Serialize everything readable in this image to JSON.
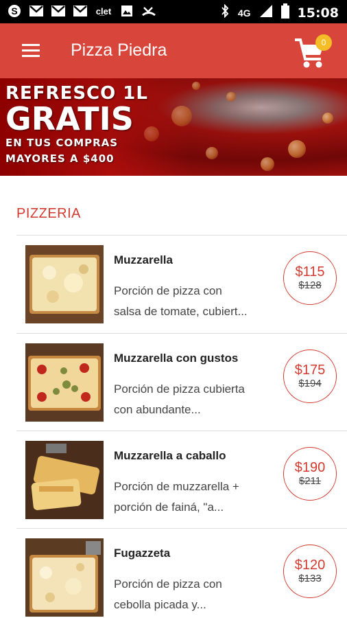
{
  "status_bar": {
    "time": "15:08",
    "network": "4G",
    "left_icons": [
      "skype-icon",
      "gmail-icon",
      "gmail-icon",
      "gmail-icon",
      "clarin-icon",
      "image-icon",
      "missed-call-icon"
    ],
    "clarin_label": "cl̲et"
  },
  "app_bar": {
    "title": "Pizza Piedra",
    "cart_count": "0"
  },
  "banner": {
    "line1": "REFRESCO 1L",
    "line2": "GRATIS",
    "line3": "EN TUS COMPRAS",
    "line4": "MAYORES A $400"
  },
  "section": {
    "title": "PIZZERIA"
  },
  "items": [
    {
      "name": "Muzzarella",
      "desc": "Porción de pizza con\nsalsa de tomate, cubiert...",
      "price": "$115",
      "old_price": "$128"
    },
    {
      "name": "Muzzarella con gustos",
      "desc": "Porción de pizza cubierta\ncon abundante...",
      "price": "$175",
      "old_price": "$194"
    },
    {
      "name": "Muzzarella a caballo",
      "desc": "Porción de muzzarella +\nporción de fainá, \"a...",
      "price": "$190",
      "old_price": "$211"
    },
    {
      "name": "Fugazzeta",
      "desc": "Porción de pizza con\ncebolla picada y...",
      "price": "$120",
      "old_price": "$133"
    }
  ],
  "colors": {
    "app_bar": "#d8453b",
    "accent": "#d33a2f",
    "badge": "#f4bd28"
  }
}
